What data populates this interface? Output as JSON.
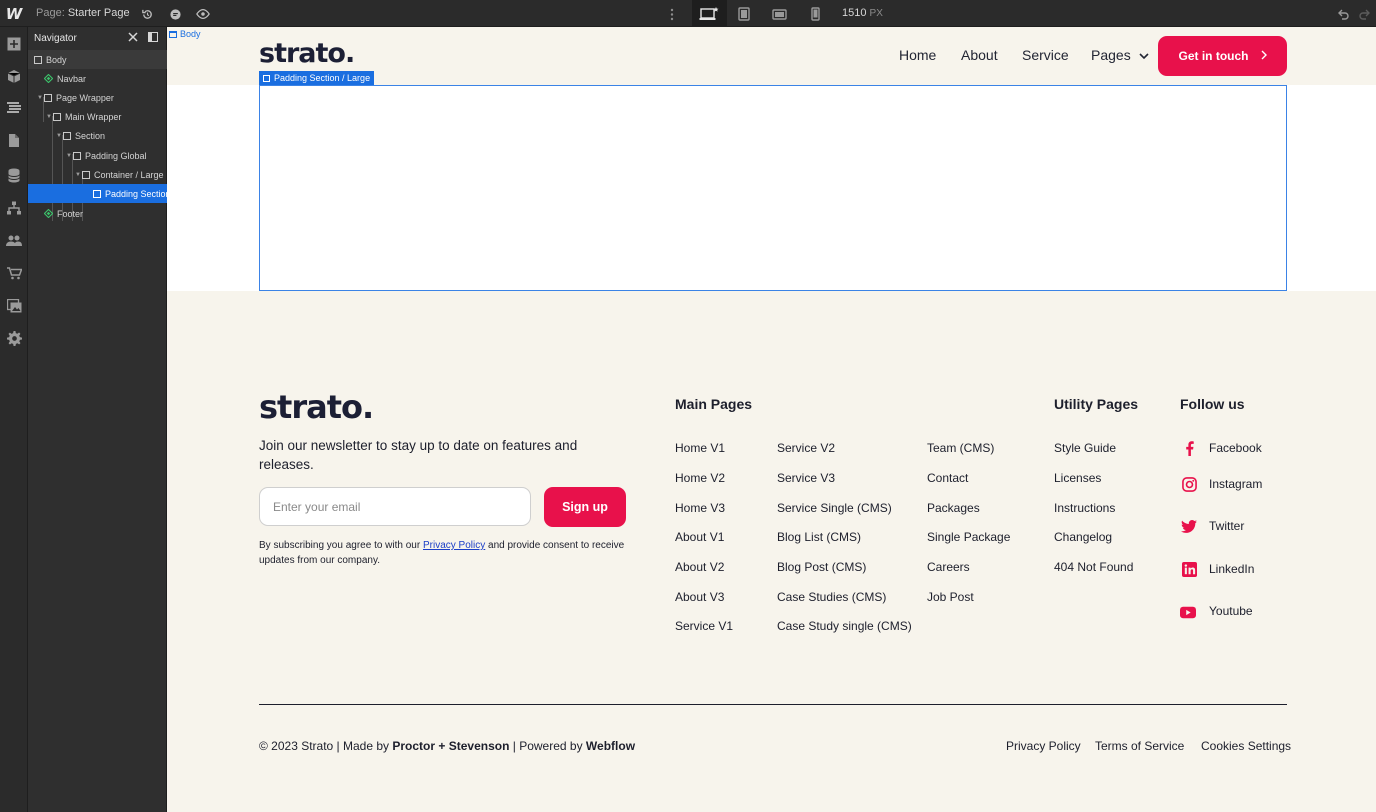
{
  "topbar": {
    "logo": "W",
    "page_prefix": "Page:",
    "page_name": "Starter Page",
    "width_value": "1510",
    "width_unit": "PX"
  },
  "navigator": {
    "title": "Navigator",
    "items": [
      {
        "label": "Body"
      },
      {
        "label": "Navbar"
      },
      {
        "label": "Page Wrapper"
      },
      {
        "label": "Main Wrapper"
      },
      {
        "label": "Section"
      },
      {
        "label": "Padding Global"
      },
      {
        "label": "Container / Large"
      },
      {
        "label": "Padding Section / Large"
      },
      {
        "label": "Footer"
      }
    ]
  },
  "canvas": {
    "body_tag": "Body",
    "selected_tag": "Padding Section / Large"
  },
  "site": {
    "logo": "strato.",
    "nav": {
      "home": "Home",
      "about": "About",
      "service": "Service",
      "pages": "Pages",
      "cta": "Get in touch"
    },
    "footer": {
      "logo": "strato.",
      "newsletter_text": "Join our newsletter to stay up to date on features and releases.",
      "email_placeholder": "Enter your email",
      "signup": "Sign up",
      "consent_pre": "By subscribing you agree to with our ",
      "consent_link": "Privacy Policy",
      "consent_post": " and provide consent to receive updates from our company.",
      "main_pages_title": "Main Pages",
      "main_col1": [
        "Home V1",
        "Home V2",
        "Home V3",
        "About V1",
        "About V2",
        "About V3",
        "Service V1"
      ],
      "main_col2": [
        "Service V2",
        "Service V3",
        "Service Single (CMS)",
        "Blog List (CMS)",
        "Blog Post (CMS)",
        "Case Studies (CMS)",
        "Case Study single (CMS)"
      ],
      "main_col3": [
        "Team (CMS)",
        "Contact",
        "Packages",
        "Single Package",
        "Careers",
        "Job Post"
      ],
      "utility_title": "Utility Pages",
      "utility": [
        "Style Guide",
        "Licenses",
        "Instructions",
        "Changelog",
        "404 Not Found"
      ],
      "follow_title": "Follow us",
      "social": [
        "Facebook",
        "Instagram",
        "Twitter",
        "LinkedIn",
        "Youtube"
      ],
      "copyright_pre": "© 2023 Strato | Made by ",
      "copyright_maker": "Proctor + Stevenson",
      "copyright_mid": " | Powered by ",
      "copyright_platform": "Webflow",
      "legal": [
        "Privacy Policy",
        "Terms of Service",
        "Cookies Settings"
      ]
    }
  },
  "colors": {
    "accent": "#e8114b",
    "selection": "#1a6ee0",
    "canvas_bg": "#f7f4ec",
    "text": "#1d1f2c"
  }
}
